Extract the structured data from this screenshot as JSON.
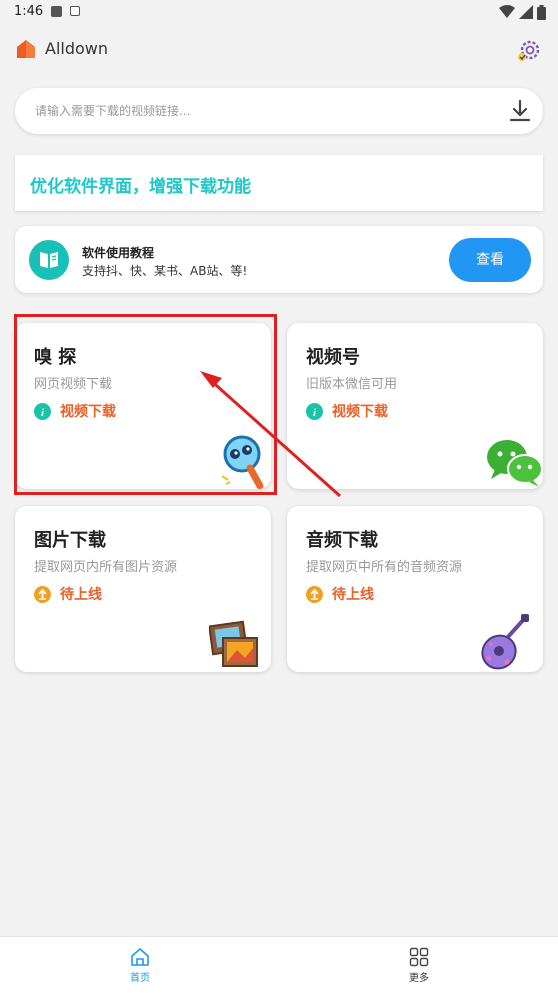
{
  "statusbar": {
    "time": "1:46"
  },
  "app": {
    "title": "Alldown"
  },
  "search": {
    "placeholder": "请输入需要下载的视频链接..."
  },
  "banner": {
    "text": "优化软件界面，增强下载功能"
  },
  "tutorial": {
    "title": "软件使用教程",
    "subtitle": "支持抖、快、某书、AB站、等!",
    "button": "查看"
  },
  "features": [
    {
      "title": "嗅 探",
      "desc": "网页视频下载",
      "status": "视频下载",
      "status_icon": "info-icon",
      "image": "magnifier-character-icon"
    },
    {
      "title": "视频号",
      "desc": "旧版本微信可用",
      "status": "视频下载",
      "status_icon": "info-icon",
      "image": "wechat-icon"
    },
    {
      "title": "图片下载",
      "desc": "提取网页内所有图片资源",
      "status": "待上线",
      "status_icon": "upload-icon",
      "image": "pictures-icon"
    },
    {
      "title": "音频下载",
      "desc": "提取网页中所有的音频资源",
      "status": "待上线",
      "status_icon": "upload-icon",
      "image": "guitar-icon"
    }
  ],
  "nav": {
    "home": "首页",
    "more": "更多"
  },
  "colors": {
    "accent": "#2196f3",
    "banner": "#1cc8c8",
    "status": "#e8602a",
    "info": "#19c3a8",
    "wait": "#f0a020",
    "highlight": "#e02020"
  }
}
